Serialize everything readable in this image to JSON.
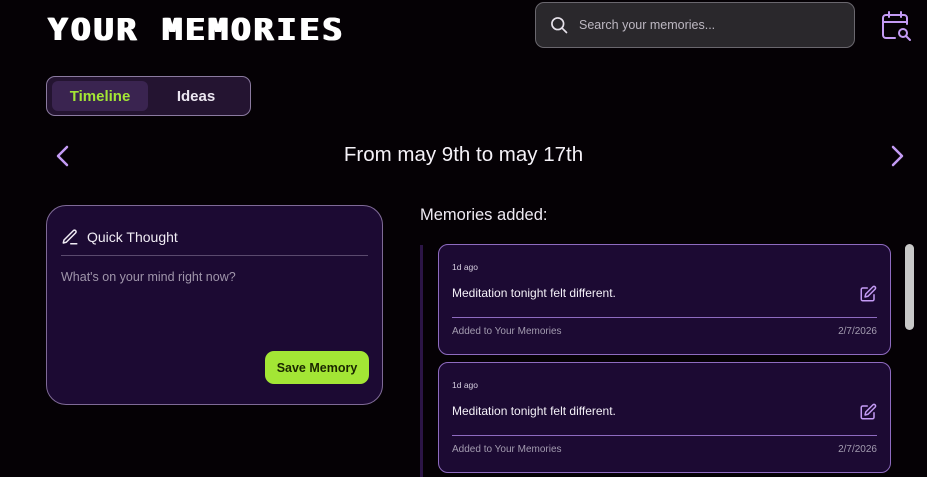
{
  "header": {
    "title": "YOUR MEMORIES",
    "search_placeholder": "Search your memories...",
    "search_value": "",
    "search_icon": "search-icon",
    "calendar_icon": "calendar-search-icon"
  },
  "tabs": [
    {
      "label": "Timeline",
      "active": true
    },
    {
      "label": "Ideas",
      "active": false
    }
  ],
  "date_nav": {
    "range_label": "From may 9th to may 17th",
    "prev_icon": "chevron-left-icon",
    "next_icon": "chevron-right-icon"
  },
  "quick_thought": {
    "title": "Quick Thought",
    "icon": "pencil-icon",
    "placeholder": "What's on your mind right now?",
    "value": "",
    "save_label": "Save Memory"
  },
  "memories": {
    "heading": "Memories added:",
    "items": [
      {
        "time_ago": "1d ago",
        "text": "Meditation tonight felt different.",
        "added_label": "Added to Your Memories",
        "date": "2/7/2026"
      },
      {
        "time_ago": "1d ago",
        "text": "Meditation tonight felt different.",
        "added_label": "Added to Your Memories",
        "date": "2/7/2026"
      }
    ]
  },
  "colors": {
    "background": "#050105",
    "accent_green": "#a3e635",
    "card_purple": "#1c0a33",
    "border_purple": "#8e6bc0",
    "icon_purple": "#c49bf5"
  }
}
